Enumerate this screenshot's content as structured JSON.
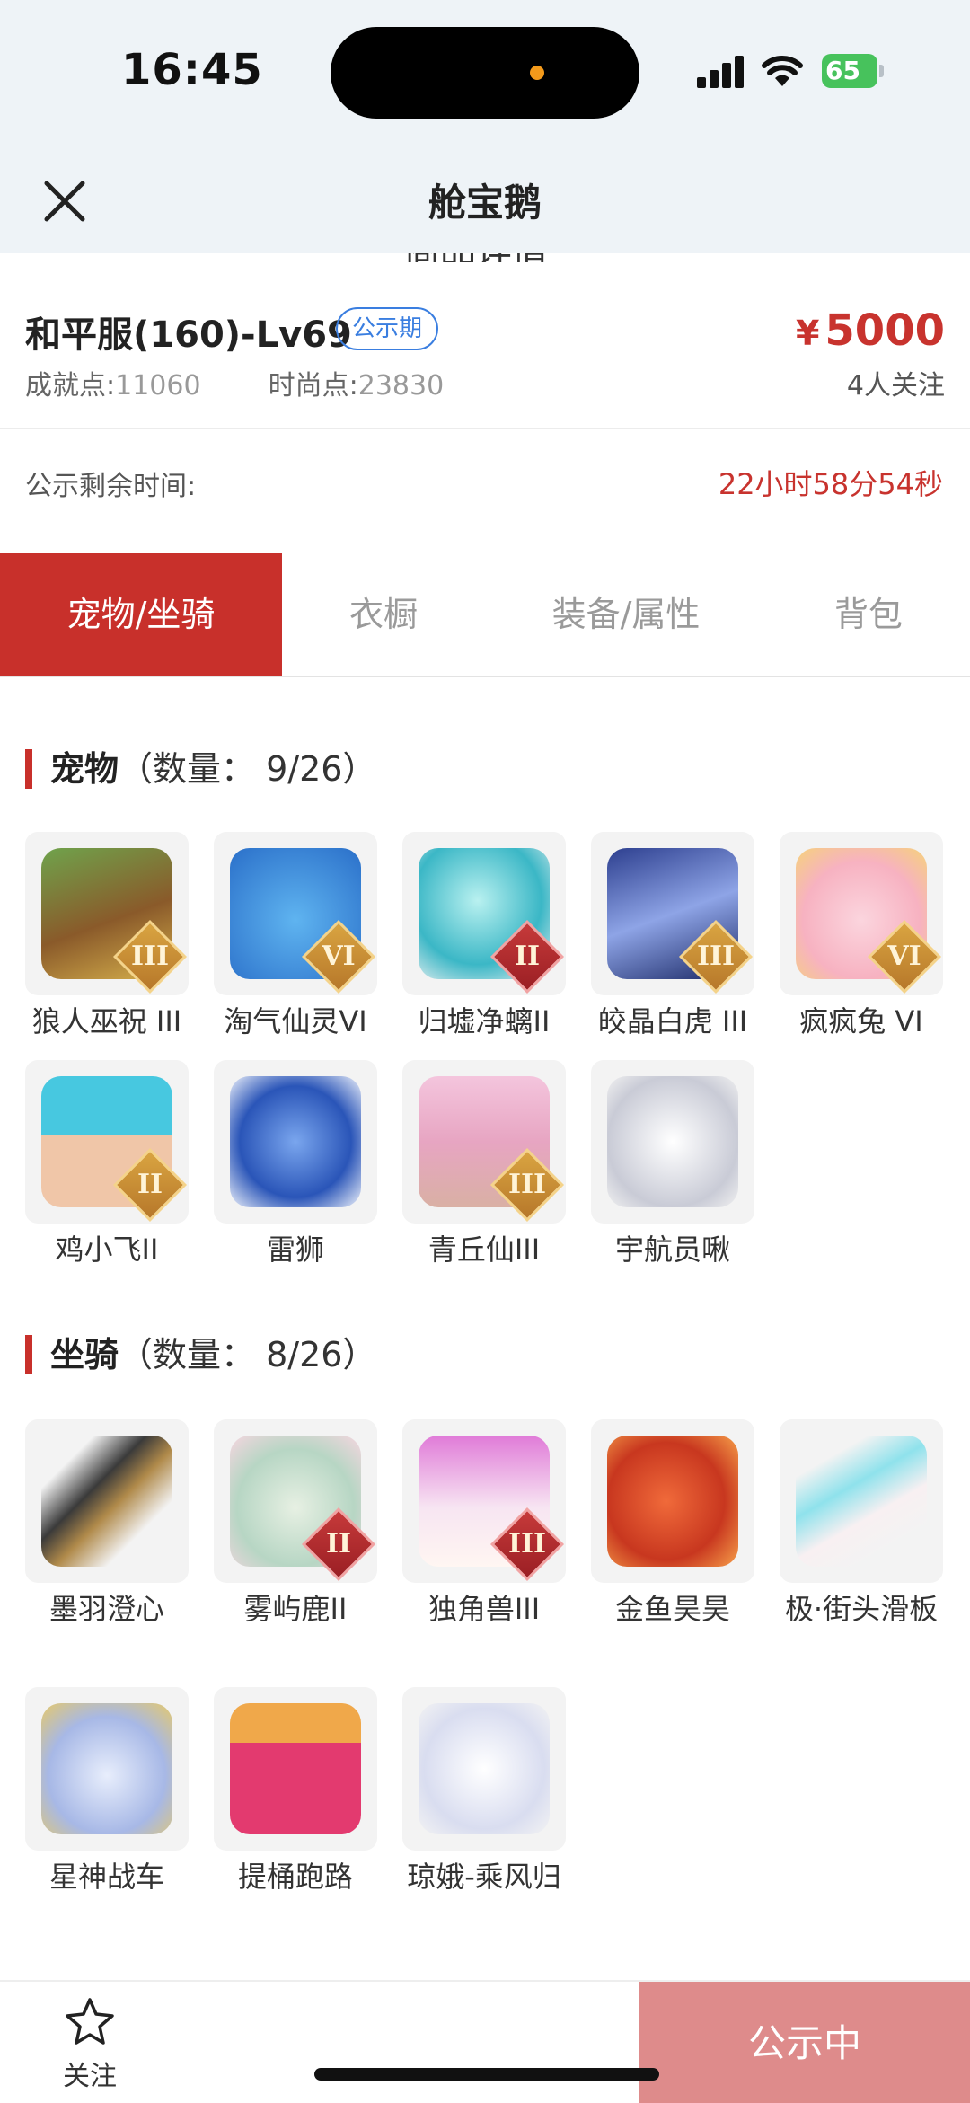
{
  "status_bar": {
    "time": "16:45",
    "battery": "65"
  },
  "header": {
    "title": "舱宝鹅",
    "hidden_subtitle": "商品详情"
  },
  "product": {
    "name": "和平服(160)-Lv69",
    "tag": "公示期",
    "price_symbol": "¥",
    "price": "5000",
    "achievement_label": "成就点:",
    "achievement_value": "11060",
    "fashion_label": "时尚点:",
    "fashion_value": "23830",
    "followers": "4人关注"
  },
  "countdown": {
    "label": "公示剩余时间:",
    "value": "22小时58分54秒"
  },
  "tabs": [
    {
      "label": "宠物/坐骑",
      "active": true
    },
    {
      "label": "衣橱",
      "active": false
    },
    {
      "label": "装备/属性",
      "active": false
    },
    {
      "label": "背包",
      "active": false
    }
  ],
  "pets": {
    "title": "宠物",
    "count": "（数量：   9/26）",
    "items": [
      {
        "name": "狼人巫祝 III",
        "badge": "III",
        "icon": "werewolf-shaman-icon"
      },
      {
        "name": "淘气仙灵VI",
        "badge": "VI",
        "icon": "blue-dog-icon"
      },
      {
        "name": "归墟净螭II",
        "badge": "II",
        "icon": "jade-dragon-icon"
      },
      {
        "name": "皎晶白虎 III",
        "badge": "III",
        "icon": "white-tiger-icon"
      },
      {
        "name": "疯疯兔 VI",
        "badge": "VI",
        "icon": "pink-rabbit-icon"
      },
      {
        "name": "鸡小飞II",
        "badge": "II",
        "icon": "blue-chick-icon"
      },
      {
        "name": "雷狮",
        "badge": "",
        "icon": "thunder-lion-icon"
      },
      {
        "name": "青丘仙III",
        "badge": "III",
        "icon": "fox-fairy-icon"
      },
      {
        "name": "宇航员啾",
        "badge": "",
        "icon": "astronaut-cow-icon"
      }
    ]
  },
  "mounts": {
    "title": "坐骑",
    "count": "（数量：   8/26）",
    "items": [
      {
        "name": "墨羽澄心",
        "badge": "",
        "icon": "feather-sword-icon"
      },
      {
        "name": "雾屿鹿II",
        "badge": "II",
        "icon": "mist-deer-icon"
      },
      {
        "name": "独角兽III",
        "badge": "III",
        "icon": "unicorn-icon"
      },
      {
        "name": "金鱼昊昊",
        "badge": "",
        "icon": "goldfish-icon"
      },
      {
        "name": "极·街头滑板",
        "badge": "",
        "icon": "skateboard-icon"
      },
      {
        "name": "星神战车",
        "badge": "",
        "icon": "star-chariot-icon"
      },
      {
        "name": "提桶跑路",
        "badge": "",
        "icon": "bucket-icon"
      },
      {
        "name": "琼娥-乘风归",
        "badge": "",
        "icon": "moon-fairy-icon"
      }
    ]
  },
  "bottom": {
    "fav_label": "关注",
    "cta_label": "公示中"
  },
  "colors": {
    "accent": "#c8302b",
    "tag_blue": "#3a7ee0",
    "cta_bg": "#de8b8b"
  }
}
